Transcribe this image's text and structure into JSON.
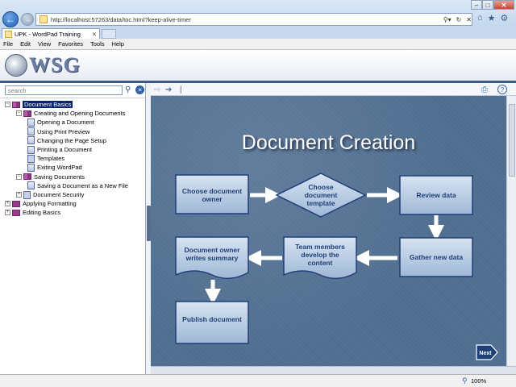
{
  "browser": {
    "url": "http://localhost:57263/data/toc.html?keep-alive-timer",
    "tab_title": "UPK - WordPad Training",
    "menu": [
      "File",
      "Edit",
      "View",
      "Favorites",
      "Tools",
      "Help"
    ],
    "zoom": "100%"
  },
  "banner": {
    "logo_text": "WSG"
  },
  "toc": {
    "search_placeholder": "search",
    "items": [
      {
        "label": "Document Basics",
        "level": 0,
        "icon": "book-open-icon",
        "expanded": true,
        "selected": true
      },
      {
        "label": "Creating and Opening Documents",
        "level": 1,
        "icon": "book-open-icon",
        "expanded": true
      },
      {
        "label": "Opening a Document",
        "level": 2,
        "icon": "topic-page-icon"
      },
      {
        "label": "Using Print Preview",
        "level": 2,
        "icon": "topic-page-icon"
      },
      {
        "label": "Changing the Page Setup",
        "level": 2,
        "icon": "topic-page-icon"
      },
      {
        "label": "Printing a Document",
        "level": 2,
        "icon": "topic-page-icon"
      },
      {
        "label": "Templates",
        "level": 2,
        "icon": "concept-page-icon"
      },
      {
        "label": "Exiting WordPad",
        "level": 2,
        "icon": "topic-page-icon"
      },
      {
        "label": "Saving Documents",
        "level": 1,
        "icon": "book-open-icon",
        "expanded": true
      },
      {
        "label": "Saving a Document as a New File",
        "level": 2,
        "icon": "topic-page-icon"
      },
      {
        "label": "Document Security",
        "level": 1,
        "icon": "concept-page-icon"
      },
      {
        "label": "Applying Formatting",
        "level": 0,
        "icon": "book-closed-icon",
        "expanded": false
      },
      {
        "label": "Editing Basics",
        "level": 0,
        "icon": "book-closed-icon",
        "expanded": false
      }
    ]
  },
  "slide": {
    "title": "Document Creation",
    "nodes": {
      "choose_owner": "Choose document owner",
      "choose_template": "Choose document template",
      "review_data": "Review data",
      "gather_data": "Gather new data",
      "team_members": "Team members develop the content",
      "owner_writes": "Document owner writes summary",
      "publish": "Publish document"
    },
    "next_label": "Next"
  },
  "colors": {
    "slide_bg": "#4f6d8f",
    "box_fill": "#bcd0e6",
    "box_text": "#1f3f78",
    "arrow": "#ffffff",
    "selection": "#0a246a"
  }
}
